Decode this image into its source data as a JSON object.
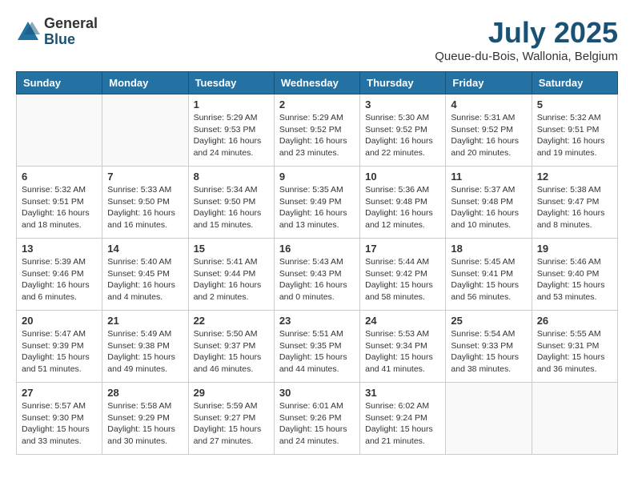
{
  "logo": {
    "general": "General",
    "blue": "Blue"
  },
  "title": "July 2025",
  "subtitle": "Queue-du-Bois, Wallonia, Belgium",
  "days_of_week": [
    "Sunday",
    "Monday",
    "Tuesday",
    "Wednesday",
    "Thursday",
    "Friday",
    "Saturday"
  ],
  "weeks": [
    [
      {
        "day": "",
        "info": ""
      },
      {
        "day": "",
        "info": ""
      },
      {
        "day": "1",
        "info": "Sunrise: 5:29 AM\nSunset: 9:53 PM\nDaylight: 16 hours and 24 minutes."
      },
      {
        "day": "2",
        "info": "Sunrise: 5:29 AM\nSunset: 9:52 PM\nDaylight: 16 hours and 23 minutes."
      },
      {
        "day": "3",
        "info": "Sunrise: 5:30 AM\nSunset: 9:52 PM\nDaylight: 16 hours and 22 minutes."
      },
      {
        "day": "4",
        "info": "Sunrise: 5:31 AM\nSunset: 9:52 PM\nDaylight: 16 hours and 20 minutes."
      },
      {
        "day": "5",
        "info": "Sunrise: 5:32 AM\nSunset: 9:51 PM\nDaylight: 16 hours and 19 minutes."
      }
    ],
    [
      {
        "day": "6",
        "info": "Sunrise: 5:32 AM\nSunset: 9:51 PM\nDaylight: 16 hours and 18 minutes."
      },
      {
        "day": "7",
        "info": "Sunrise: 5:33 AM\nSunset: 9:50 PM\nDaylight: 16 hours and 16 minutes."
      },
      {
        "day": "8",
        "info": "Sunrise: 5:34 AM\nSunset: 9:50 PM\nDaylight: 16 hours and 15 minutes."
      },
      {
        "day": "9",
        "info": "Sunrise: 5:35 AM\nSunset: 9:49 PM\nDaylight: 16 hours and 13 minutes."
      },
      {
        "day": "10",
        "info": "Sunrise: 5:36 AM\nSunset: 9:48 PM\nDaylight: 16 hours and 12 minutes."
      },
      {
        "day": "11",
        "info": "Sunrise: 5:37 AM\nSunset: 9:48 PM\nDaylight: 16 hours and 10 minutes."
      },
      {
        "day": "12",
        "info": "Sunrise: 5:38 AM\nSunset: 9:47 PM\nDaylight: 16 hours and 8 minutes."
      }
    ],
    [
      {
        "day": "13",
        "info": "Sunrise: 5:39 AM\nSunset: 9:46 PM\nDaylight: 16 hours and 6 minutes."
      },
      {
        "day": "14",
        "info": "Sunrise: 5:40 AM\nSunset: 9:45 PM\nDaylight: 16 hours and 4 minutes."
      },
      {
        "day": "15",
        "info": "Sunrise: 5:41 AM\nSunset: 9:44 PM\nDaylight: 16 hours and 2 minutes."
      },
      {
        "day": "16",
        "info": "Sunrise: 5:43 AM\nSunset: 9:43 PM\nDaylight: 16 hours and 0 minutes."
      },
      {
        "day": "17",
        "info": "Sunrise: 5:44 AM\nSunset: 9:42 PM\nDaylight: 15 hours and 58 minutes."
      },
      {
        "day": "18",
        "info": "Sunrise: 5:45 AM\nSunset: 9:41 PM\nDaylight: 15 hours and 56 minutes."
      },
      {
        "day": "19",
        "info": "Sunrise: 5:46 AM\nSunset: 9:40 PM\nDaylight: 15 hours and 53 minutes."
      }
    ],
    [
      {
        "day": "20",
        "info": "Sunrise: 5:47 AM\nSunset: 9:39 PM\nDaylight: 15 hours and 51 minutes."
      },
      {
        "day": "21",
        "info": "Sunrise: 5:49 AM\nSunset: 9:38 PM\nDaylight: 15 hours and 49 minutes."
      },
      {
        "day": "22",
        "info": "Sunrise: 5:50 AM\nSunset: 9:37 PM\nDaylight: 15 hours and 46 minutes."
      },
      {
        "day": "23",
        "info": "Sunrise: 5:51 AM\nSunset: 9:35 PM\nDaylight: 15 hours and 44 minutes."
      },
      {
        "day": "24",
        "info": "Sunrise: 5:53 AM\nSunset: 9:34 PM\nDaylight: 15 hours and 41 minutes."
      },
      {
        "day": "25",
        "info": "Sunrise: 5:54 AM\nSunset: 9:33 PM\nDaylight: 15 hours and 38 minutes."
      },
      {
        "day": "26",
        "info": "Sunrise: 5:55 AM\nSunset: 9:31 PM\nDaylight: 15 hours and 36 minutes."
      }
    ],
    [
      {
        "day": "27",
        "info": "Sunrise: 5:57 AM\nSunset: 9:30 PM\nDaylight: 15 hours and 33 minutes."
      },
      {
        "day": "28",
        "info": "Sunrise: 5:58 AM\nSunset: 9:29 PM\nDaylight: 15 hours and 30 minutes."
      },
      {
        "day": "29",
        "info": "Sunrise: 5:59 AM\nSunset: 9:27 PM\nDaylight: 15 hours and 27 minutes."
      },
      {
        "day": "30",
        "info": "Sunrise: 6:01 AM\nSunset: 9:26 PM\nDaylight: 15 hours and 24 minutes."
      },
      {
        "day": "31",
        "info": "Sunrise: 6:02 AM\nSunset: 9:24 PM\nDaylight: 15 hours and 21 minutes."
      },
      {
        "day": "",
        "info": ""
      },
      {
        "day": "",
        "info": ""
      }
    ]
  ]
}
